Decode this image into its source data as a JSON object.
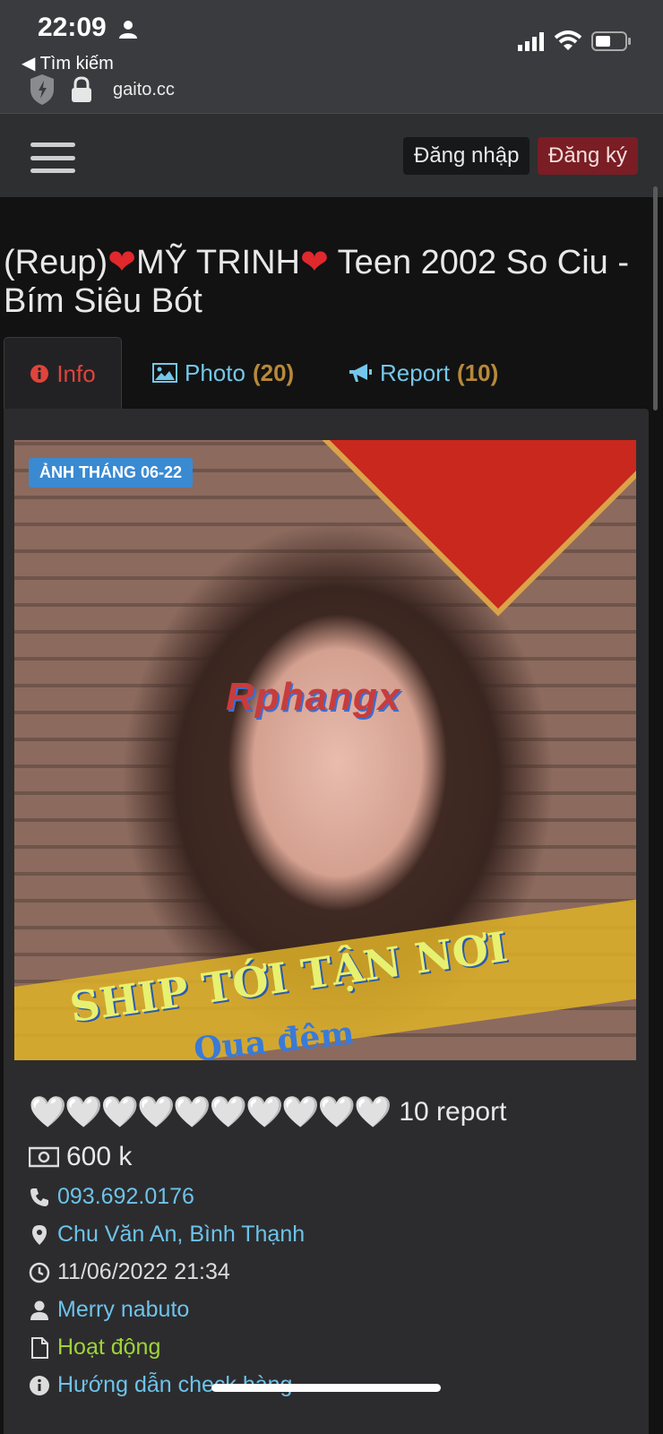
{
  "status_bar": {
    "time": "22:09",
    "back_label": "◀ Tìm kiếm",
    "url": "gaito.cc"
  },
  "navbar": {
    "login_label": "Đăng nhập",
    "register_label": "Đăng ký"
  },
  "post": {
    "title_prefix": "(Reup)",
    "title_heart": "❤",
    "title_name": "MỸ TRINH",
    "title_suffix": " Teen 2002 So Ciu - Bím Siêu Bót"
  },
  "tabs": [
    {
      "label": "Info"
    },
    {
      "label": "Photo",
      "count": "(20)"
    },
    {
      "label": "Report",
      "count": "(10)"
    }
  ],
  "photo": {
    "badge": "ẢNH THÁNG 06-22",
    "watermark": "Rphangx",
    "caption_line1": "SHIP TỚI TẬN NƠI",
    "caption_line2": "Qua đêm"
  },
  "details": {
    "hearts": "🤍🤍🤍🤍🤍🤍🤍🤍🤍🤍",
    "rating_text": "10 report",
    "price": "600 k",
    "phone": "093.692.0176",
    "location": "Chu Văn An, Bình Thạnh",
    "datetime": "11/06/2022 21:34",
    "user": "Merry nabuto",
    "status": "Hoạt động",
    "guide": "Hướng dẫn check hàng"
  },
  "colors": {
    "accent_red": "#e0443b",
    "link_blue": "#6dc3ea",
    "count_gold": "#b8893a",
    "status_green": "#9ed43a",
    "register_bg": "#7a1d24"
  }
}
